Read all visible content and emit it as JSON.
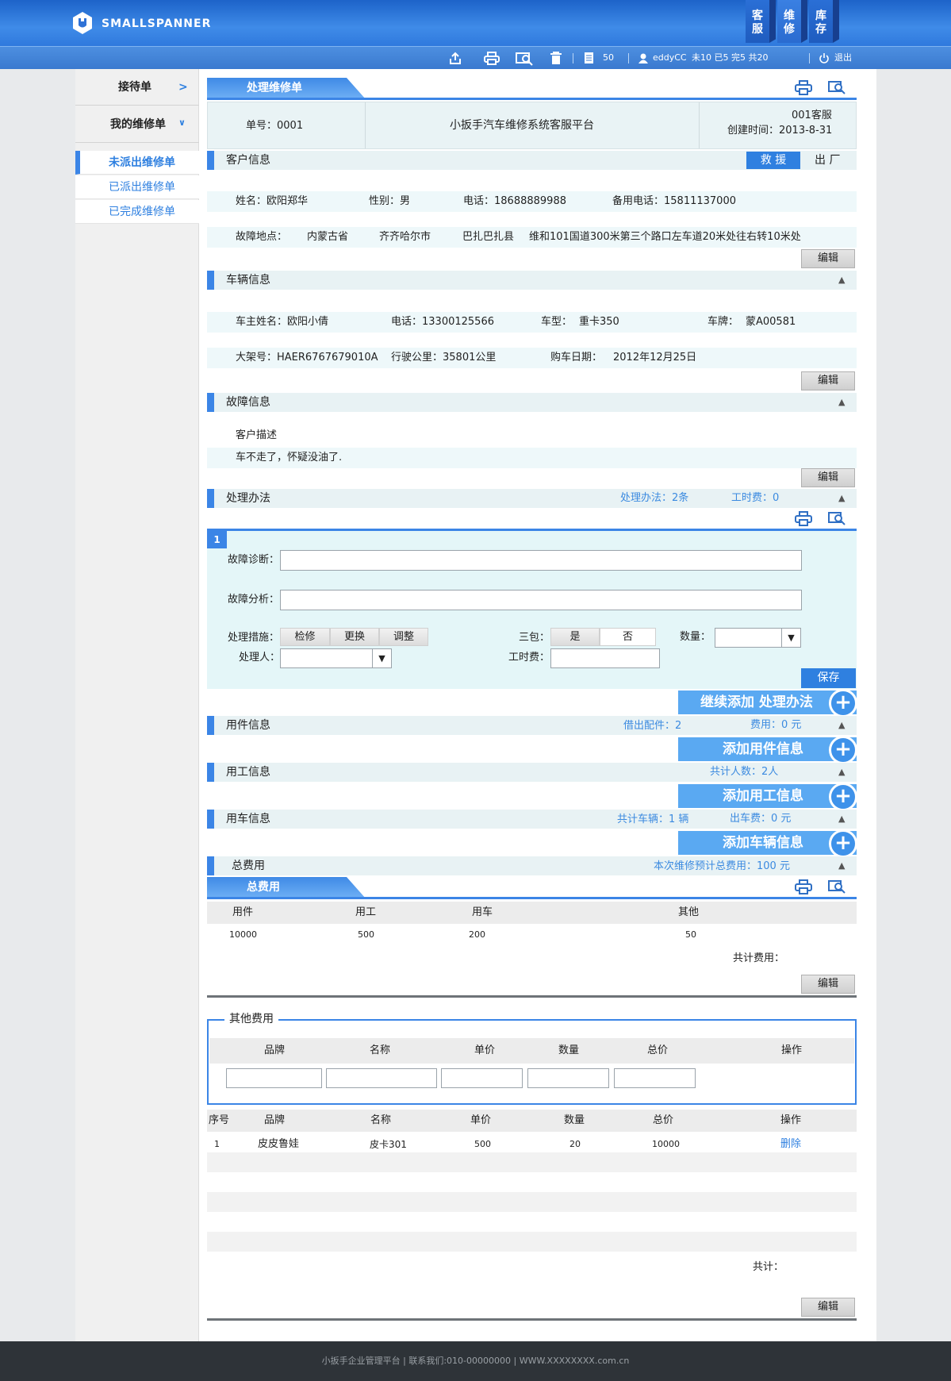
{
  "brand": {
    "name": "SMALLSPANNER"
  },
  "topnav": [
    {
      "label": "客\n服"
    },
    {
      "label": "维\n修"
    },
    {
      "label": "库\n存"
    }
  ],
  "toolbar": {
    "count": "50",
    "user": "eddyCC",
    "stats": "未10 已5 完5 共20",
    "logout": "退出"
  },
  "sidebar": {
    "reception": "接待单",
    "my_orders": "我的维修单",
    "items": [
      {
        "label": "未派出维修单"
      },
      {
        "label": "已派出维修单"
      },
      {
        "label": "已完成维修单"
      }
    ]
  },
  "order": {
    "tab": "处理维修单",
    "number": "单号：0001",
    "platform": "小扳手汽车维修系统客服平台",
    "agent": "001客服",
    "created": "创建时间：2013-8-31"
  },
  "customer": {
    "title": "客户信息",
    "rescue": "救 援",
    "leave": "出 厂",
    "name": "姓名：欧阳郑华",
    "gender": "性别：男",
    "phone": "电话：18688889988",
    "backup_phone": "备用电话：15811137000",
    "location_label": "故障地点：",
    "province": "内蒙古省",
    "city": "齐齐哈尔市",
    "county": "巴扎巴扎县",
    "address": "维和101国道300米第三个路口左车道20米处往右转10米处",
    "edit": "编辑"
  },
  "vehicle": {
    "title": "车辆信息",
    "owner": "车主姓名：欧阳小倩",
    "phone": "电话：13300125566",
    "model_label": "车型：",
    "model": "重卡350",
    "plate_label": "车牌：",
    "plate": "蒙A00581",
    "vin": "大架号：HAER6767679010A",
    "mileage": "行驶公里：35801公里",
    "purchase_label": "购车日期：",
    "purchase": "2012年12月25日",
    "edit": "编辑"
  },
  "fault": {
    "title": "故障信息",
    "desc_label": "客户描述",
    "desc": "车不走了，怀疑没油了.",
    "edit": "编辑"
  },
  "method": {
    "title": "处理办法",
    "count": "处理办法：2条",
    "fee": "工时费：0",
    "index": "1",
    "diag_label": "故障诊断：",
    "analysis_label": "故障分析：",
    "measure_label": "处理措施：",
    "measures": [
      "检修",
      "更换",
      "调整"
    ],
    "warranty_label": "三包：",
    "warranty": [
      "是",
      "否"
    ],
    "qty_label": "数量：",
    "handler_label": "处理人：",
    "labor_label": "工时费：",
    "save": "保存",
    "add": "继续添加 处理办法"
  },
  "parts": {
    "title": "用件信息",
    "borrowed": "借出配件：2",
    "fee": "费用：0 元",
    "add": "添加用件信息"
  },
  "labor": {
    "title": "用工信息",
    "people": "共计人数：2人",
    "add": "添加用工信息"
  },
  "car": {
    "title": "用车信息",
    "vehicles": "共计车辆：1 辆",
    "fee": "出车费：0 元",
    "add": "添加车辆信息"
  },
  "total": {
    "title": "总费用",
    "estimate": "本次维修预计总费用：100 元",
    "tab": "总费用",
    "headers": [
      "用件",
      "用工",
      "用车",
      "其他"
    ],
    "values": [
      "10000",
      "500",
      "200",
      "50"
    ],
    "sum_label": "共计费用：",
    "edit": "编辑"
  },
  "other": {
    "legend": "其他费用",
    "headers": [
      "品牌",
      "名称",
      "单价",
      "数量",
      "总价",
      "操作"
    ],
    "list_headers": [
      "序号",
      "品牌",
      "名称",
      "单价",
      "数量",
      "总价",
      "操作"
    ],
    "rows": [
      {
        "no": "1",
        "brand": "皮皮鲁娃",
        "name": "皮卡301",
        "price": "500",
        "qty": "20",
        "total": "10000",
        "op": "删除"
      }
    ],
    "sum_label": "共计：",
    "edit": "编辑"
  },
  "footer": {
    "text": "小扳手企业管理平台 | 联系我们:010-00000000 | WWW.XXXXXXXX.com.cn"
  },
  "colors": {
    "accent": "#3b85e6",
    "light": "#eef8fa"
  }
}
